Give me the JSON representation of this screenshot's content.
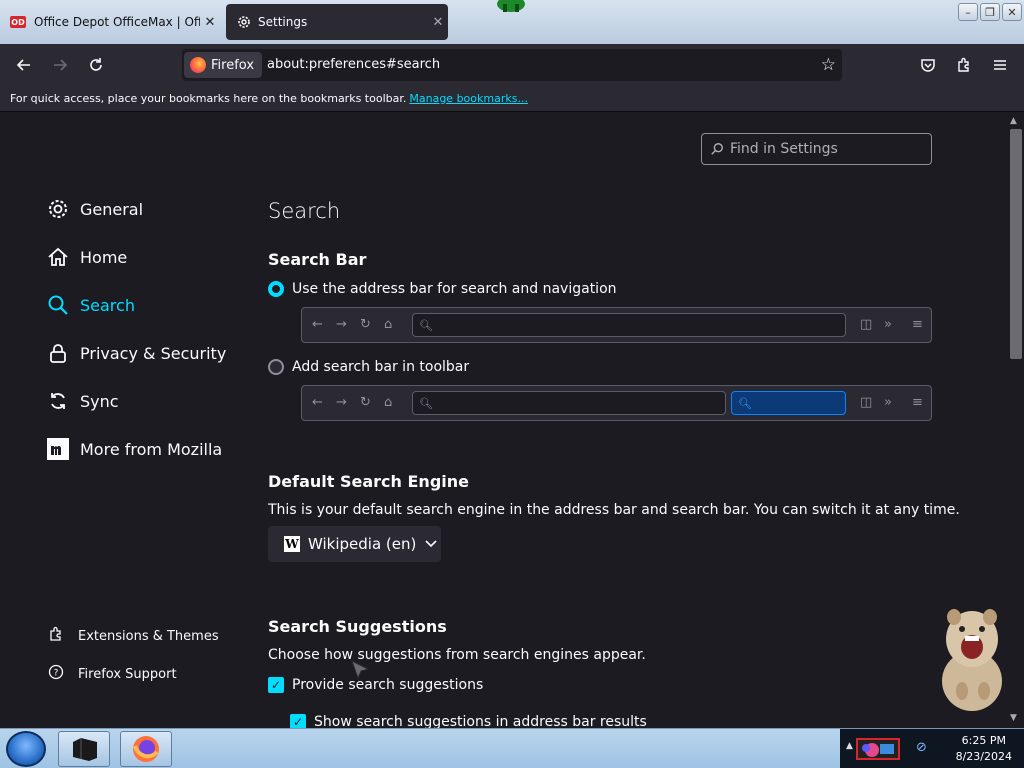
{
  "tabs": [
    {
      "title": "Office Depot OfficeMax | Official",
      "favicon": "OD",
      "active": false
    },
    {
      "title": "Settings",
      "active": true
    }
  ],
  "window_controls": {
    "minimize": "–",
    "restore": "❐",
    "close": "✕"
  },
  "nav": {
    "identity_label": "Firefox",
    "url": "about:preferences#search"
  },
  "bookmarks_bar": {
    "message": "For quick access, place your bookmarks here on the bookmarks toolbar.",
    "link": "Manage bookmarks..."
  },
  "find": {
    "placeholder": "Find in Settings"
  },
  "sidebar": {
    "items": [
      {
        "label": "General",
        "icon": "gear-icon"
      },
      {
        "label": "Home",
        "icon": "home-icon"
      },
      {
        "label": "Search",
        "icon": "search-icon",
        "active": true
      },
      {
        "label": "Privacy & Security",
        "icon": "lock-icon"
      },
      {
        "label": "Sync",
        "icon": "sync-icon"
      },
      {
        "label": "More from Mozilla",
        "icon": "mozilla-icon"
      }
    ],
    "footer": [
      {
        "label": "Extensions & Themes",
        "icon": "puzzle-icon"
      },
      {
        "label": "Firefox Support",
        "icon": "help-icon"
      }
    ]
  },
  "main": {
    "page_title": "Search",
    "search_bar": {
      "heading": "Search Bar",
      "option_address": "Use the address bar for search and navigation",
      "option_toolbar": "Add search bar in toolbar",
      "selected": "address"
    },
    "default_engine": {
      "heading": "Default Search Engine",
      "description": "This is your default search engine in the address bar and search bar. You can switch it at any time.",
      "selected": "Wikipedia (en)"
    },
    "suggestions": {
      "heading": "Search Suggestions",
      "description": "Choose how suggestions from search engines appear.",
      "provide": "Provide search suggestions",
      "address_bar": "Show search suggestions in address bar results"
    }
  },
  "taskbar": {
    "time": "6:25 PM",
    "date": "8/23/2024"
  },
  "colors": {
    "accent": "#00ddff",
    "background": "#1c1b22",
    "surface": "#2b2a33"
  }
}
